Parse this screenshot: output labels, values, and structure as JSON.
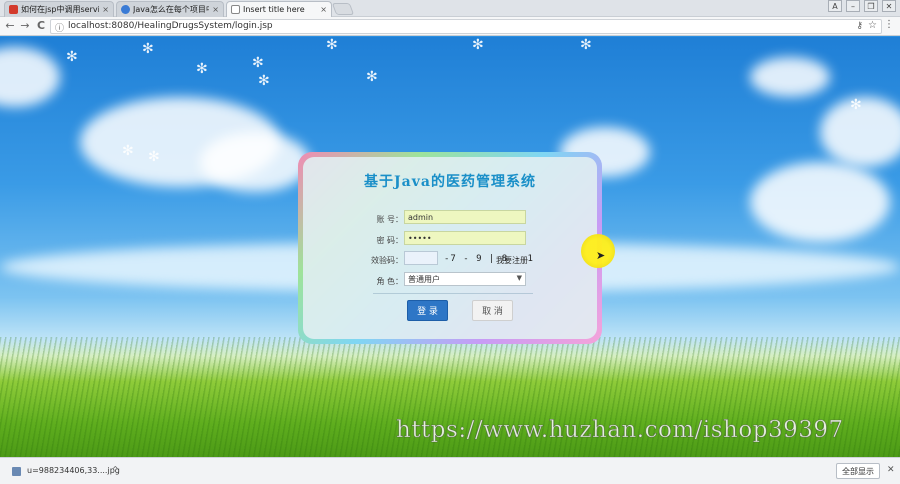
{
  "browser": {
    "tabs": [
      {
        "title": "如何在jsp中调用service",
        "favicon_color": "#d33a2c",
        "active": false
      },
      {
        "title": "Java怎么在每个项目中导",
        "favicon_color": "#3a7bd5",
        "active": false
      },
      {
        "title": "Insert title here",
        "favicon_color": "#888888",
        "active": true
      }
    ],
    "tab_close_glyph": "×",
    "window_controls": [
      "A",
      "–",
      "❐",
      "✕"
    ],
    "nav": {
      "back": "←",
      "forward": "→",
      "reload": "C"
    },
    "url": "localhost:8080/HealingDrugsSystem/login.jsp",
    "info_glyph": "ⓘ",
    "key_glyph": "⚷",
    "star_glyph": "☆",
    "menu_glyph": "⋮"
  },
  "login": {
    "title": "基于Java的医药管理系统",
    "account_label": "账 号：",
    "account_value": "admin",
    "password_label": "密 码：",
    "password_value": "•••••",
    "captcha_label": "效验码：",
    "captcha_text": "-7 - 9 | 8 - 1",
    "register_link": "我要注册",
    "role_label": "角 色：",
    "role_selected": "普通用户",
    "login_button": "登 录",
    "cancel_button": "取 消"
  },
  "watermark": "https://www.huzhan.com/ishop39397",
  "downloads": {
    "file_name": "u=988234406,33....jpg",
    "show_all": "全部显示",
    "chevron": "^",
    "close": "✕"
  },
  "colors": {
    "title_blue": "#1a8fc8",
    "login_button": "#2e76c6",
    "input_highlight": "#eef7c0",
    "cursor_highlight": "#ffef1a"
  }
}
